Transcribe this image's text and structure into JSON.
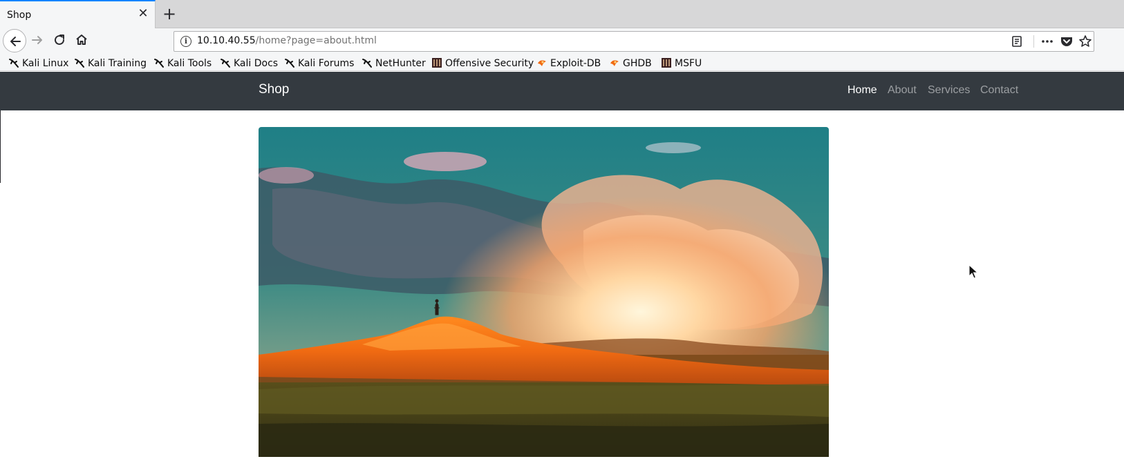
{
  "browser": {
    "tab": {
      "title": "Shop"
    },
    "url": {
      "host": "10.10.40.55",
      "path": "/home?page=about.html"
    },
    "bookmarks": [
      {
        "label": "Kali Linux",
        "icon": "kali-dragon-icon"
      },
      {
        "label": "Kali Training",
        "icon": "kali-dragon-icon"
      },
      {
        "label": "Kali Tools",
        "icon": "kali-dragon-icon"
      },
      {
        "label": "Kali Docs",
        "icon": "kali-dragon-icon"
      },
      {
        "label": "Kali Forums",
        "icon": "kali-dragon-icon"
      },
      {
        "label": "NetHunter",
        "icon": "kali-dragon-icon"
      },
      {
        "label": "Offensive Security",
        "icon": "offsec-icon"
      },
      {
        "label": "Exploit-DB",
        "icon": "exploit-db-icon"
      },
      {
        "label": "GHDB",
        "icon": "exploit-db-icon"
      },
      {
        "label": "MSFU",
        "icon": "offsec-icon"
      }
    ]
  },
  "site": {
    "brand": "Shop",
    "nav": [
      {
        "label": "Home",
        "active": true
      },
      {
        "label": "About",
        "active": false
      },
      {
        "label": "Services",
        "active": false
      },
      {
        "label": "Contact",
        "active": false
      }
    ]
  },
  "colors": {
    "navbar_bg": "#343a40",
    "tab_accent": "#0a84ff",
    "sky_teal": "#2f8f8f",
    "hill_orange": "#f06a12"
  }
}
